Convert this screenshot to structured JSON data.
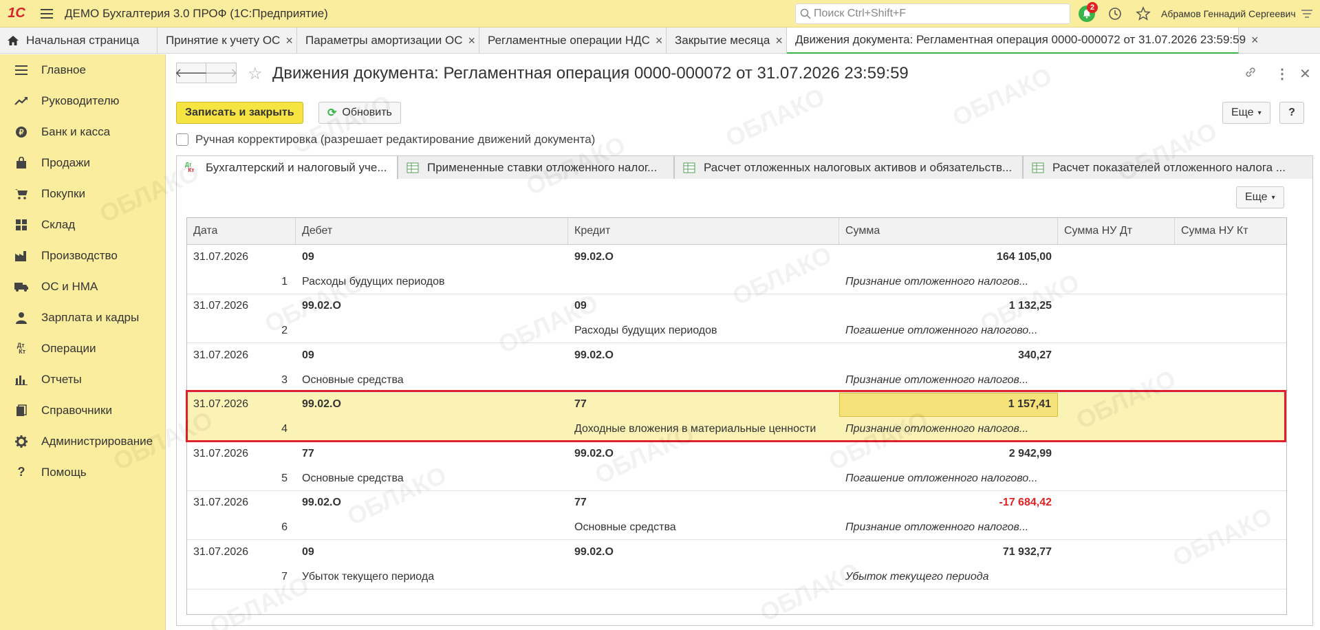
{
  "app": {
    "logo_text": "1С",
    "title": "ДЕМО Бухгалтерия 3.0 ПРОФ  (1С:Предприятие)"
  },
  "search": {
    "placeholder": "Поиск Ctrl+Shift+F"
  },
  "notifications": {
    "count": "2"
  },
  "user": {
    "name": "Абрамов Геннадий Сергеевич"
  },
  "tabs": [
    {
      "label": "Начальная страница"
    },
    {
      "label": "Принятие к учету ОС"
    },
    {
      "label": "Параметры амортизации ОС"
    },
    {
      "label": "Регламентные операции НДС"
    },
    {
      "label": "Закрытие месяца"
    },
    {
      "label": "Движения документа: Регламентная операция 0000-000072 от 31.07.2026 23:59:59"
    }
  ],
  "sidebar": {
    "items": [
      {
        "label": "Главное",
        "icon": "menu-lines-icon"
      },
      {
        "label": "Руководителю",
        "icon": "trend-up-icon"
      },
      {
        "label": "Банк и касса",
        "icon": "coin-icon"
      },
      {
        "label": "Продажи",
        "icon": "bag-icon"
      },
      {
        "label": "Покупки",
        "icon": "cart-icon"
      },
      {
        "label": "Склад",
        "icon": "warehouse-icon"
      },
      {
        "label": "Производство",
        "icon": "factory-icon"
      },
      {
        "label": "ОС и НМА",
        "icon": "truck-icon"
      },
      {
        "label": "Зарплата и кадры",
        "icon": "person-icon"
      },
      {
        "label": "Операции",
        "icon": "dt-kt-icon"
      },
      {
        "label": "Отчеты",
        "icon": "bar-chart-icon"
      },
      {
        "label": "Справочники",
        "icon": "books-icon"
      },
      {
        "label": "Администрирование",
        "icon": "gear-icon"
      },
      {
        "label": "Помощь",
        "icon": "question-icon"
      }
    ]
  },
  "document": {
    "title": "Движения документа: Регламентная операция 0000-000072 от 31.07.2026 23:59:59",
    "save_close_label": "Записать и закрыть",
    "refresh_label": "Обновить",
    "more_label": "Еще",
    "help_label": "?",
    "manual_correction_label": "Ручная корректировка (разрешает редактирование движений документа)"
  },
  "subtabs": [
    {
      "label": "Бухгалтерский и налоговый уче..."
    },
    {
      "label": "Примененные ставки отложенного налог..."
    },
    {
      "label": "Расчет отложенных налоговых активов и обязательств..."
    },
    {
      "label": "Расчет показателей отложенного налога ..."
    }
  ],
  "table": {
    "more_label": "Еще",
    "columns": [
      "Дата",
      "Дебет",
      "Кредит",
      "Сумма",
      "Сумма НУ Дт",
      "Сумма НУ Кт"
    ],
    "rows": [
      {
        "date": "31.07.2026",
        "num": "1",
        "debit": "09",
        "debit_sub": "Расходы будущих периодов",
        "credit": "99.02.О",
        "credit_sub": "",
        "sum": "164 105,00",
        "content": "Признание отложенного налогов..."
      },
      {
        "date": "31.07.2026",
        "num": "2",
        "debit": "99.02.О",
        "debit_sub": "",
        "credit": "09",
        "credit_sub": "Расходы будущих периодов",
        "sum": "1 132,25",
        "content": "Погашение отложенного налогово..."
      },
      {
        "date": "31.07.2026",
        "num": "3",
        "debit": "09",
        "debit_sub": "Основные средства",
        "credit": "99.02.О",
        "credit_sub": "",
        "sum": "340,27",
        "content": "Признание отложенного налогов..."
      },
      {
        "date": "31.07.2026",
        "num": "4",
        "debit": "99.02.О",
        "debit_sub": "",
        "credit": "77",
        "credit_sub": "Доходные вложения в материальные ценности",
        "sum": "1 157,41",
        "content": "Признание отложенного налогов..."
      },
      {
        "date": "31.07.2026",
        "num": "5",
        "debit": "77",
        "debit_sub": "Основные средства",
        "credit": "99.02.О",
        "credit_sub": "",
        "sum": "2 942,99",
        "content": "Погашение отложенного налогово..."
      },
      {
        "date": "31.07.2026",
        "num": "6",
        "debit": "99.02.О",
        "debit_sub": "",
        "credit": "77",
        "credit_sub": "Основные средства",
        "sum": "-17 684,42",
        "content": "Признание отложенного налогов..."
      },
      {
        "date": "31.07.2026",
        "num": "7",
        "debit": "09",
        "debit_sub": "Убыток текущего периода",
        "credit": "99.02.О",
        "credit_sub": "",
        "sum": "71 932,77",
        "content": "Убыток текущего периода"
      }
    ]
  },
  "watermark": {
    "text": "ОБЛАКО"
  },
  "colors": {
    "accent_yellow": "#fbed9e",
    "primary_button": "#f5e442",
    "green": "#3ab54a",
    "negative": "#e02222",
    "selection_frame": "#e0202a"
  }
}
